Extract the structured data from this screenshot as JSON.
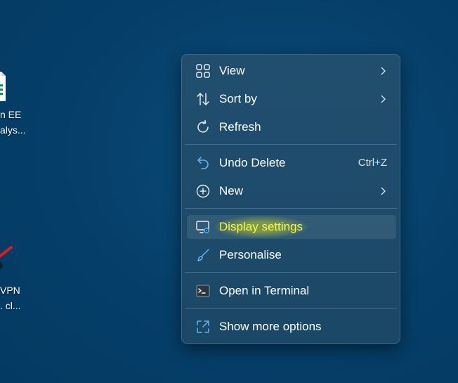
{
  "desktop": {
    "icons": [
      {
        "line1": "n EE",
        "line2": "alys..."
      },
      {
        "line1": "VPN",
        "line2": ". cl..."
      }
    ]
  },
  "context_menu": {
    "items": [
      {
        "label": "View",
        "icon": "grid-icon",
        "submenu": true
      },
      {
        "label": "Sort by",
        "icon": "sort-arrows-icon",
        "submenu": true
      },
      {
        "label": "Refresh",
        "icon": "refresh-icon",
        "submenu": false
      },
      {
        "label": "Undo Delete",
        "icon": "undo-icon",
        "shortcut": "Ctrl+Z"
      },
      {
        "label": "New",
        "icon": "plus-circle-icon",
        "submenu": true
      },
      {
        "label": "Display settings",
        "icon": "display-settings-icon",
        "highlighted": true
      },
      {
        "label": "Personalise",
        "icon": "brush-icon"
      },
      {
        "label": "Open in Terminal",
        "icon": "terminal-icon"
      },
      {
        "label": "Show more options",
        "icon": "expand-icon"
      }
    ]
  },
  "colors": {
    "desktop_bg": "#04416b",
    "menu_bg": "#1f4a69",
    "accent_icon": "#5fb4f0",
    "highlight_text": "#f4fb3a"
  }
}
